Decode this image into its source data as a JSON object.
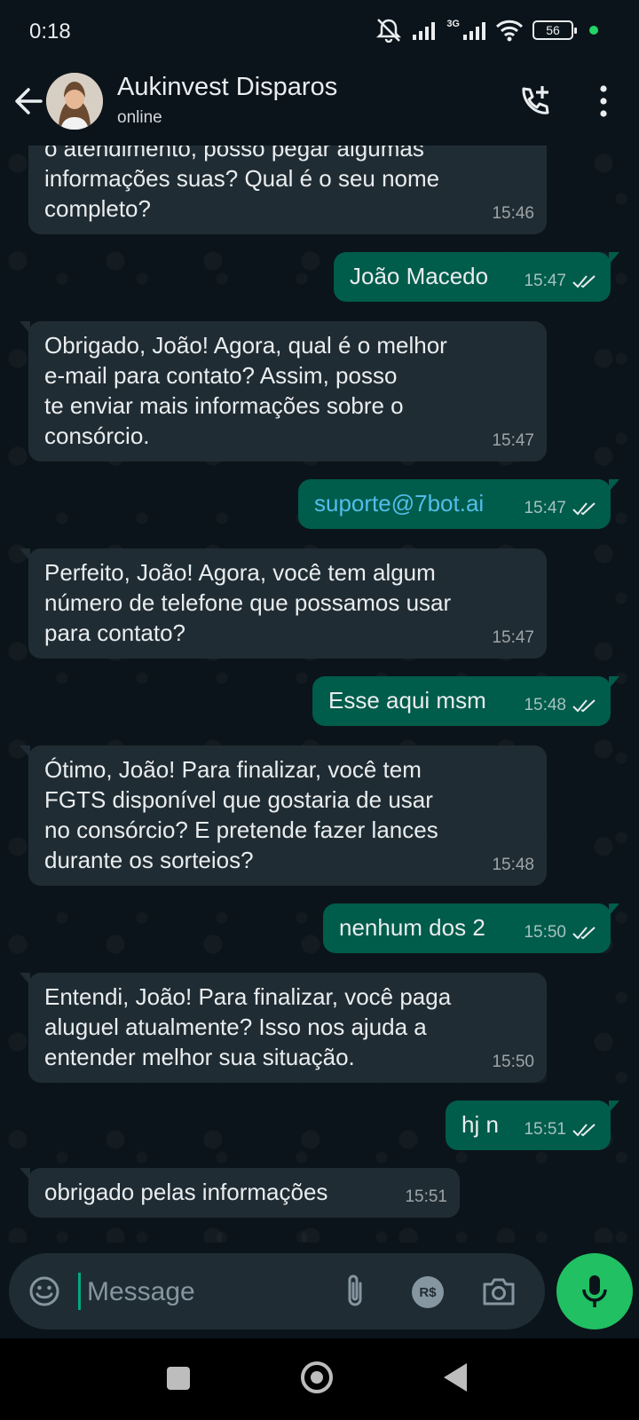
{
  "status_bar": {
    "time": "0:18",
    "battery": "56",
    "network": "3G"
  },
  "header": {
    "title": "Aukinvest Disparos",
    "subtitle": "online"
  },
  "messages": [
    {
      "direction": "in",
      "text": "o atendimento, posso pegar algumas\ninformações suas? Qual é o seu nome\ncompleto?",
      "time": "15:46"
    },
    {
      "direction": "out",
      "text": "João Macedo",
      "time": "15:47"
    },
    {
      "direction": "in",
      "text": "Obrigado, João! Agora, qual é o melhor\ne-mail para contato? Assim, posso\nte enviar mais informações sobre o\nconsórcio.",
      "time": "15:47"
    },
    {
      "direction": "out",
      "text": "suporte@7bot.ai",
      "time": "15:47"
    },
    {
      "direction": "in",
      "text": "Perfeito, João! Agora, você tem algum\nnúmero de telefone que possamos usar\npara contato?",
      "time": "15:47"
    },
    {
      "direction": "out",
      "text": "Esse aqui msm",
      "time": "15:48"
    },
    {
      "direction": "in",
      "text": "Ótimo, João! Para finalizar, você tem\nFGTS disponível que gostaria de usar\nno consórcio? E pretende fazer lances\ndurante os sorteios?",
      "time": "15:48"
    },
    {
      "direction": "out",
      "text": "nenhum dos 2",
      "time": "15:50"
    },
    {
      "direction": "in",
      "text": "Entendi, João! Para finalizar, você paga\naluguel atualmente? Isso nos ajuda a\nentender melhor sua situação.",
      "time": "15:50"
    },
    {
      "direction": "out",
      "text": "hj n",
      "time": "15:51"
    },
    {
      "direction": "in",
      "text": "obrigado pelas informações",
      "time": "15:51"
    }
  ],
  "input": {
    "placeholder": "Message",
    "currency_label": "R$"
  },
  "colors": {
    "incoming_bubble": "#202c33",
    "outgoing_bubble": "#005c4b",
    "accent": "#21c063",
    "link": "#53bdeb",
    "read_ticks": "#e9edef"
  }
}
